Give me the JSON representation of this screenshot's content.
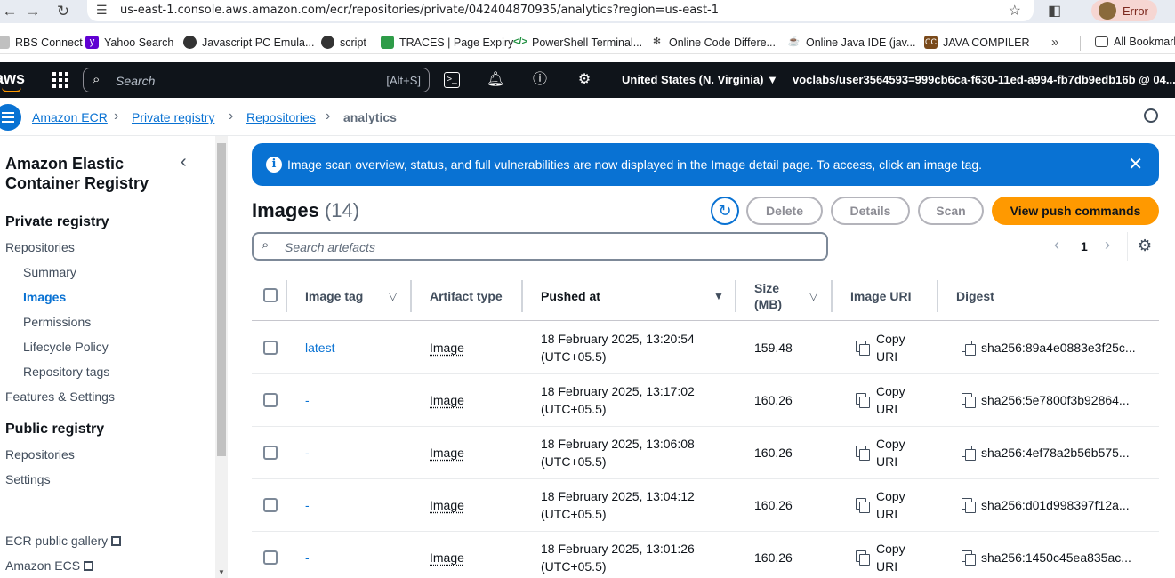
{
  "browser": {
    "url": "us-east-1.console.aws.amazon.com/ecr/repositories/private/042404870935/analytics?region=us-east-1",
    "profile_label": "Error",
    "bookmarks": [
      {
        "label": "RBS Connect",
        "icon": "bookmark-icon"
      },
      {
        "label": "Yahoo Search",
        "icon": "yahoo-icon"
      },
      {
        "label": "Javascript PC Emula...",
        "icon": "globe-icon"
      },
      {
        "label": "script",
        "icon": "globe-icon"
      },
      {
        "label": "TRACES | Page Expiry",
        "icon": "traces-icon"
      },
      {
        "label": "PowerShell Terminal...",
        "icon": "code-icon"
      },
      {
        "label": "Online Code Differe...",
        "icon": "gear-icon"
      },
      {
        "label": "Online Java IDE (jav...",
        "icon": "java-icon"
      },
      {
        "label": "JAVA COMPILER",
        "icon": "cc-icon"
      }
    ],
    "bookmarks_more": "»",
    "all_bookmarks": "All Bookmarks"
  },
  "aws_nav": {
    "logo": "aws",
    "search_placeholder": "Search",
    "search_shortcut": "[Alt+S]",
    "region": "United States (N. Virginia) ▼",
    "user": "voclabs/user3564593=999cb6ca-f630-11ed-a994-fb7db9edb16b @ 04... ▼"
  },
  "breadcrumb": {
    "items": [
      "Amazon ECR",
      "Private registry",
      "Repositories"
    ],
    "current": "analytics"
  },
  "sidebar": {
    "title": "Amazon Elastic Container Registry",
    "private_heading": "Private registry",
    "private_items": [
      "Repositories",
      "Summary",
      "Images",
      "Permissions",
      "Lifecycle Policy",
      "Repository tags"
    ],
    "features": "Features & Settings",
    "public_heading": "Public registry",
    "public_items": [
      "Repositories",
      "Settings"
    ],
    "links": [
      "ECR public gallery",
      "Amazon ECS"
    ]
  },
  "flash": {
    "message": "Image scan overview, status, and full vulnerabilities are now displayed in the Image detail page. To access, click an image tag."
  },
  "images": {
    "title": "Images",
    "count": "(14)",
    "buttons": {
      "delete": "Delete",
      "details": "Details",
      "scan": "Scan",
      "push": "View push commands"
    },
    "filter_placeholder": "Search artefacts",
    "page": "1",
    "columns": {
      "tag": "Image tag",
      "artifact": "Artifact type",
      "pushed": "Pushed at",
      "size": "Size (MB)",
      "uri": "Image URI",
      "digest": "Digest"
    },
    "rows": [
      {
        "tag": "latest",
        "artifact": "Image",
        "pushed_date": "18 February 2025, 13:20:54",
        "pushed_tz": "(UTC+05.5)",
        "size": "159.48",
        "copy1": "Copy",
        "copy2": "URI",
        "digest": "sha256:89a4e0883e3f25c..."
      },
      {
        "tag": "-",
        "artifact": "Image",
        "pushed_date": "18 February 2025, 13:17:02",
        "pushed_tz": "(UTC+05.5)",
        "size": "160.26",
        "copy1": "Copy",
        "copy2": "URI",
        "digest": "sha256:5e7800f3b92864..."
      },
      {
        "tag": "-",
        "artifact": "Image",
        "pushed_date": "18 February 2025, 13:06:08",
        "pushed_tz": "(UTC+05.5)",
        "size": "160.26",
        "copy1": "Copy",
        "copy2": "URI",
        "digest": "sha256:4ef78a2b56b575..."
      },
      {
        "tag": "-",
        "artifact": "Image",
        "pushed_date": "18 February 2025, 13:04:12",
        "pushed_tz": "(UTC+05.5)",
        "size": "160.26",
        "copy1": "Copy",
        "copy2": "URI",
        "digest": "sha256:d01d998397f12a..."
      },
      {
        "tag": "-",
        "artifact": "Image",
        "pushed_date": "18 February 2025, 13:01:26",
        "pushed_tz": "(UTC+05.5)",
        "size": "160.26",
        "copy1": "Copy",
        "copy2": "URI",
        "digest": "sha256:1450c45ea835ac..."
      }
    ]
  },
  "colors": {
    "accent": "#0972d3",
    "primary_button": "#ff9900",
    "nav_bg": "#0f141a"
  }
}
